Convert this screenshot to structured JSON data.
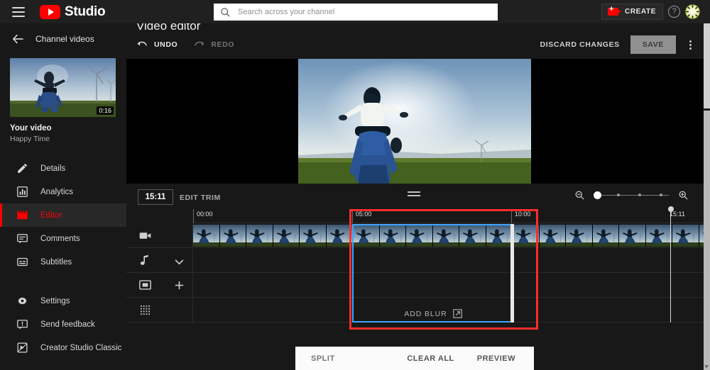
{
  "topbar": {
    "menu_icon": "hamburger-icon",
    "logo_text": "Studio",
    "search_placeholder": "Search across your channel",
    "search_value": "",
    "create_label": "CREATE",
    "help_label": "?",
    "avatar_label": "avatar"
  },
  "sidebar": {
    "back_label": "Channel videos",
    "thumbnail_duration": "0:16",
    "video_title": "Your video",
    "video_subtitle": "Happy Time",
    "items": [
      {
        "label": "Details",
        "icon": "pencil-icon",
        "active": false
      },
      {
        "label": "Analytics",
        "icon": "analytics-icon",
        "active": false
      },
      {
        "label": "Editor",
        "icon": "clapperboard-icon",
        "active": true
      },
      {
        "label": "Comments",
        "icon": "comment-icon",
        "active": false
      },
      {
        "label": "Subtitles",
        "icon": "subtitles-icon",
        "active": false
      }
    ],
    "footer_items": [
      {
        "label": "Settings",
        "icon": "gear-icon"
      },
      {
        "label": "Send feedback",
        "icon": "feedback-icon"
      },
      {
        "label": "Creator Studio Classic",
        "icon": "creator-studio-classic-icon"
      }
    ]
  },
  "editor": {
    "page_title": "Video editor",
    "undo_label": "UNDO",
    "redo_label": "REDO",
    "discard_label": "DISCARD CHANGES",
    "save_label": "SAVE",
    "more_options": "more-options"
  },
  "timeline_controls": {
    "current_time": "15:11",
    "edit_trim_label": "EDIT TRIM",
    "zoom_out_icon": "zoom-out-icon",
    "zoom_in_icon": "zoom-in-icon",
    "zoom_value": 0
  },
  "timeline": {
    "ruler_marks": [
      {
        "label": "00:00",
        "pos": 0
      },
      {
        "label": "05:00",
        "pos": 31.1
      },
      {
        "label": "10:00",
        "pos": 62.2
      },
      {
        "label": "15:11",
        "pos": 94.5
      }
    ],
    "tracks": [
      {
        "name": "video-track",
        "icon": "video-camera-icon",
        "action": ""
      },
      {
        "name": "audio-track",
        "icon": "music-note-icon",
        "action": "chevron-down-icon"
      },
      {
        "name": "end-screen-track",
        "icon": "picture-in-picture-icon",
        "action": "plus-icon"
      },
      {
        "name": "blur-track",
        "icon": "blur-grid-icon",
        "action": ""
      }
    ],
    "selection": {
      "start_label": "05:00",
      "end_label": "10:00",
      "add_blur_label": "ADD BLUR",
      "add_blur_icon": "external-link-icon",
      "accent_color": "#3ea6ff",
      "annotation_color": "#ff2d2d"
    },
    "playhead_time": "15:11"
  },
  "bottom_bar": {
    "split_label": "SPLIT",
    "clear_all_label": "CLEAR ALL",
    "preview_label": "PREVIEW"
  }
}
